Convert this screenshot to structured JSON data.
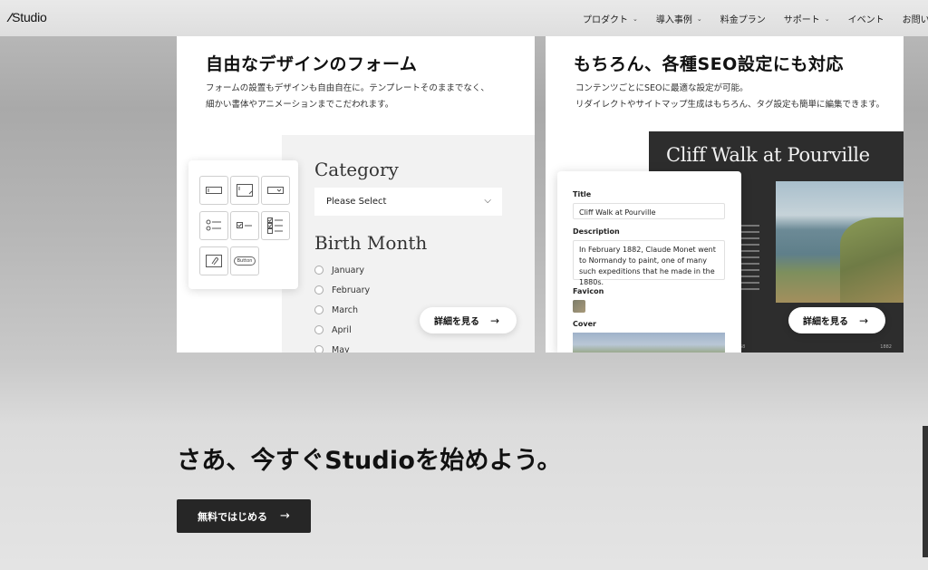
{
  "header": {
    "logo": "Studio",
    "nav": [
      {
        "label": "プロダクト",
        "dropdown": true
      },
      {
        "label": "導入事例",
        "dropdown": true
      },
      {
        "label": "料金プラン",
        "dropdown": false
      },
      {
        "label": "サポート",
        "dropdown": true
      },
      {
        "label": "イベント",
        "dropdown": false
      },
      {
        "label": "お問い合わせ",
        "dropdown": false
      }
    ]
  },
  "form_card": {
    "title": "自由なデザインのフォーム",
    "desc_line1": "フォームの設置もデザインも自由自在に。テンプレートそのままでなく、",
    "desc_line2": "細かい書体やアニメーションまでこだわれます。",
    "category_label": "Category",
    "select_placeholder": "Please Select",
    "birth_month_label": "Birth Month",
    "months": [
      "January",
      "February",
      "March",
      "April",
      "May"
    ],
    "palette_button_chip": "Button",
    "more_label": "詳細を見る"
  },
  "seo_card": {
    "title": "もちろん、各種SEO設定にも対応",
    "desc_line1": "コンテンツごとにSEOに最適な設定が可能。",
    "desc_line2": "リダイレクトやサイトマップ生成はもちろん、タグ設定も簡単に編集できます。",
    "preview_title": "Cliff Walk at Pourville",
    "preview_foot_left": "58",
    "preview_foot_right": "1882",
    "field_title_label": "Title",
    "field_title_value": "Cliff Walk at Pourville",
    "field_desc_label": "Description",
    "field_desc_value": "In February 1882, Claude Monet went to Normandy to paint, one of many such expeditions that he made in the 1880s.",
    "field_favicon_label": "Favicon",
    "field_cover_label": "Cover",
    "more_label": "詳細を見る"
  },
  "cta": {
    "title": "さあ、今すぐStudioを始めよう。",
    "button_label": "無料ではじめる"
  }
}
